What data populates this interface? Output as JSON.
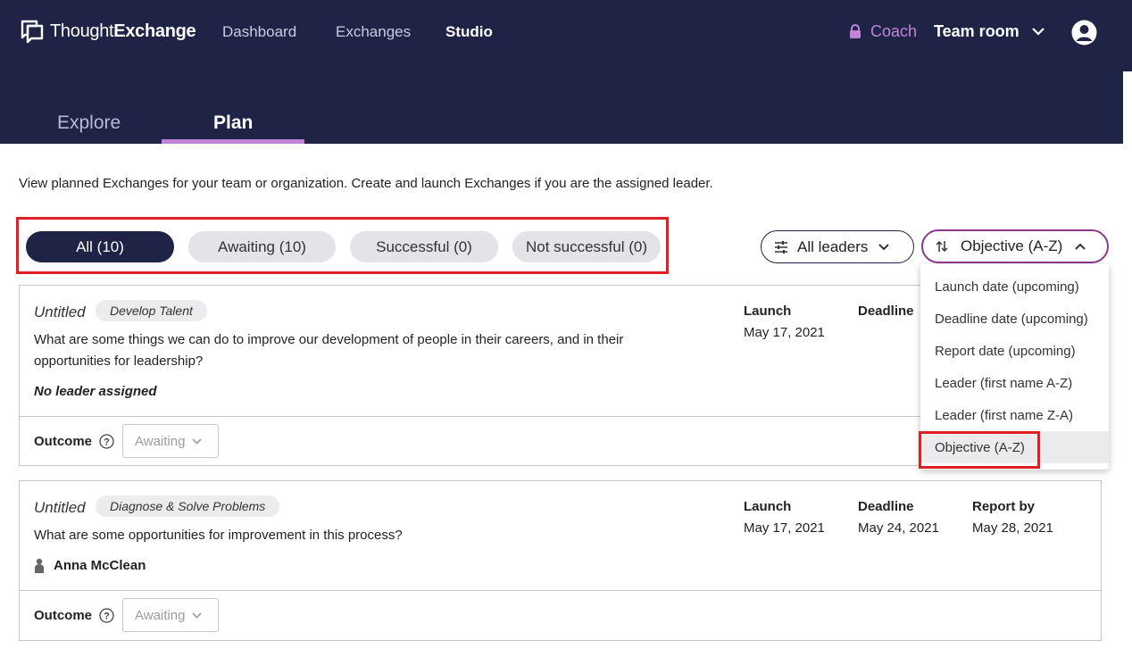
{
  "header": {
    "logo_thought": "Thought",
    "logo_exchange": "Exchange",
    "nav": [
      "Dashboard",
      "Exchanges",
      "Studio"
    ],
    "coach_label": "Coach",
    "team_room_label": "Team room"
  },
  "subtabs": {
    "explore": "Explore",
    "plan": "Plan"
  },
  "description": "View planned Exchanges for your team or organization. Create and launch Exchanges if you are the assigned leader.",
  "filters": [
    "All (10)",
    "Awaiting (10)",
    "Successful (0)",
    "Not successful (0)"
  ],
  "leaders_filter": "All leaders",
  "sort": {
    "selected": "Objective (A-Z)"
  },
  "sort_options": [
    "Launch date (upcoming)",
    "Deadline date (upcoming)",
    "Report date (upcoming)",
    "Leader (first name A-Z)",
    "Leader (first name Z-A)",
    "Objective (A-Z)"
  ],
  "cards": [
    {
      "title": "Untitled",
      "tag": "Develop Talent",
      "question": "What are some things we can do to improve our development of people in their careers, and in their opportunities for leadership?",
      "leader": "No leader assigned",
      "launch_label": "Launch",
      "launch": "May 17, 2021",
      "deadline_label": "Deadline",
      "outcome_label": "Outcome",
      "outcome_value": "Awaiting"
    },
    {
      "title": "Untitled",
      "tag": "Diagnose & Solve Problems",
      "question": "What are some opportunities for improvement in this process?",
      "leader": "Anna McClean",
      "launch_label": "Launch",
      "launch": "May 17, 2021",
      "deadline_label": "Deadline",
      "deadline": "May 24, 2021",
      "report_label": "Report by",
      "report": "May 28, 2021",
      "outcome_label": "Outcome",
      "outcome_value": "Awaiting"
    }
  ],
  "colors": {
    "header_bg": "#1f2447",
    "accent": "#c084d6",
    "sort_border": "#8b3a8f",
    "highlight": "#e01e25"
  }
}
